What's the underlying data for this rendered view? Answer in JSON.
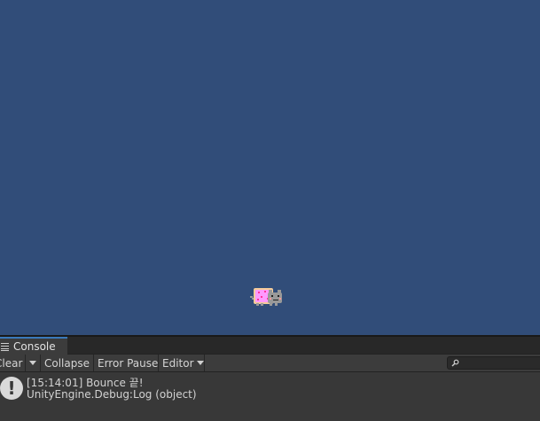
{
  "console": {
    "tab_label": "Console",
    "toolbar": {
      "clear_label": "Clear",
      "collapse_label": "Collapse",
      "error_pause_label": "Error Pause",
      "editor_label": "Editor"
    },
    "search": {
      "placeholder": ""
    },
    "entries": [
      {
        "icon": "info-icon",
        "message": "[15:14:01] Bounce 끝!",
        "stack": "UnityEngine.Debug:Log (object)"
      }
    ]
  },
  "scene": {
    "background_color": "#314d79",
    "sprite": "nyan-cat-sprite"
  }
}
